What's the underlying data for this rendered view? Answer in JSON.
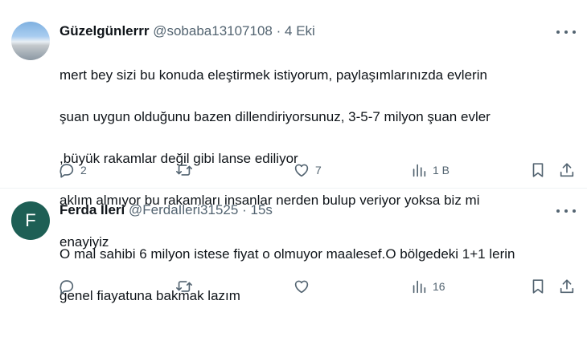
{
  "tweets": [
    {
      "display_name": "Güzelgünlerrr",
      "handle": "@sobaba13107108",
      "separator": "·",
      "time": "4 Eki",
      "avatar_letter": "",
      "lines": [
        "mert bey sizi bu konuda eleştirmek istiyorum, paylaşımlarınızda evlerin",
        "şuan uygun olduğunu bazen dillendiriyorsunuz, 3-5-7 milyon şuan evler",
        ",büyük rakamlar değil gibi lanse ediliyor",
        "aklım almıyor bu rakamları insanlar nerden bulup veriyor yoksa biz mi",
        "enayiyiz"
      ],
      "stats": {
        "replies": "2",
        "reposts": "",
        "likes": "7",
        "views": "1 B"
      }
    },
    {
      "display_name": "Ferda Ileri",
      "handle": "@FerdaIleri31525",
      "separator": "·",
      "time": "15s",
      "avatar_letter": "F",
      "lines": [
        "O mal sahibi 6 milyon istese fiyat o olmuyor maalesef.O bölgedeki 1+1 lerin",
        "genel fiayatuna bakmak lazım"
      ],
      "stats": {
        "replies": "",
        "reposts": "",
        "likes": "",
        "views": "16"
      }
    }
  ],
  "icons": {
    "avatar_1": "landscape-photo",
    "reply": "speech-bubble-icon",
    "repost": "repost-arrows-icon",
    "like": "heart-icon",
    "views": "bar-chart-icon",
    "bookmark": "bookmark-icon",
    "share": "share-upload-icon",
    "more": "ellipsis-icon"
  },
  "colors": {
    "text": "#0f1419",
    "muted": "#536471",
    "divider": "#eff3f4",
    "avatar_2_bg": "#1e5f55"
  }
}
